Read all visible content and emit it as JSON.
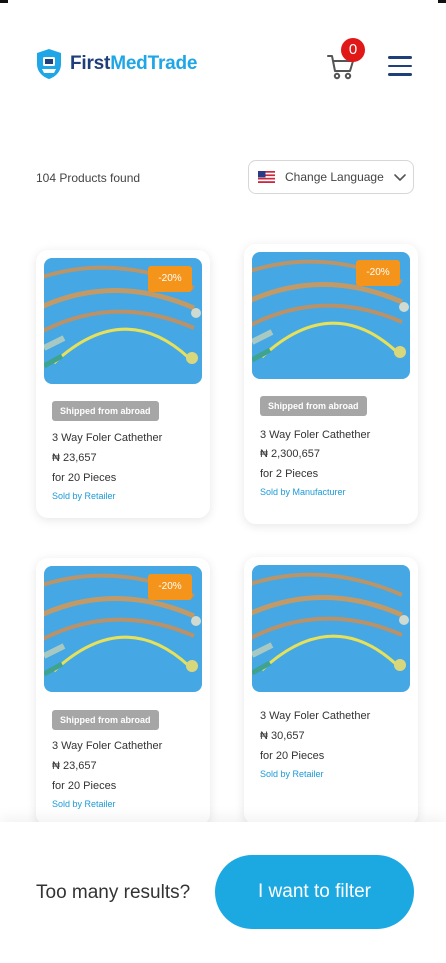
{
  "header": {
    "logo_first": "First",
    "logo_rest": "MedTrade",
    "cart_count": "0"
  },
  "toolbar": {
    "products_found": "104 Products found",
    "language_label": "Change Language"
  },
  "products": [
    {
      "discount": "-20%",
      "shipped": "Shipped from abroad",
      "name": "3 Way Foler Cathether",
      "price": "₦ 23,657",
      "quantity": "for 20 Pieces",
      "seller": "Sold by Retailer"
    },
    {
      "discount": "-20%",
      "shipped": "Shipped from abroad",
      "name": "3 Way Foler Cathether",
      "price": "₦ 2,300,657",
      "quantity": "for 2 Pieces",
      "seller": "Sold by Manufacturer"
    },
    {
      "discount": "-20%",
      "shipped": "Shipped from abroad",
      "name": "3 Way Foler Cathether",
      "price": "₦ 23,657",
      "quantity": "for 20 Pieces",
      "seller": "Sold by Retailer"
    },
    {
      "discount": "",
      "shipped": "",
      "name": "3 Way Foler Cathether",
      "price": "₦ 30,657",
      "quantity": "for 20 Pieces",
      "seller": "Sold by Retailer"
    }
  ],
  "footer": {
    "prompt": "Too many results?",
    "filter_button": "I want to filter"
  },
  "colors": {
    "brand_navy": "#1e3f7a",
    "brand_blue": "#1fa6e6",
    "discount_orange": "#f5941a",
    "badge_red": "#e01818",
    "shipped_gray": "#a6a6a6",
    "seller_blue": "#1a9ad8"
  },
  "icons": [
    "logo-shield-icon",
    "cart-icon",
    "hamburger-menu-icon",
    "us-flag-icon",
    "chevron-down-icon"
  ]
}
